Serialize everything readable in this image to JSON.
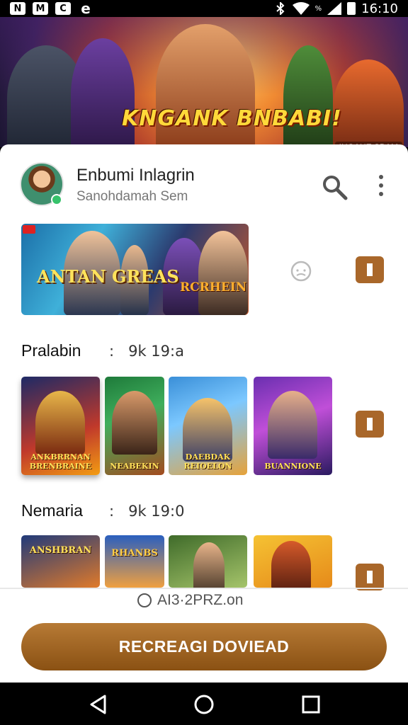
{
  "status_bar": {
    "battery_pct": "%",
    "time": "16:10",
    "icons": [
      "n-icon",
      "m-icon",
      "c-icon",
      "e-icon"
    ],
    "left_glyphs": [
      "N",
      "M",
      "C",
      "e"
    ]
  },
  "banner": {
    "title": "KNGANK BNBABI!",
    "badge": "IHGAHE SBAM"
  },
  "app": {
    "name": "Enbumi Inlagrin",
    "subtitle": "Sanohdamah Sem"
  },
  "featured": {
    "title_left": "ANTAN GREAS",
    "title_right": "RCRHEIN"
  },
  "sections": [
    {
      "title": "Pralabin",
      "meta_sep": ":",
      "meta": "9k 19:a",
      "tiles": [
        "ANKBRRNAN BRENBRAINE",
        "NEABEKIN",
        "DAEBDAK REIOELON",
        "BUANNIONE"
      ]
    },
    {
      "title": "Nemaria",
      "meta_sep": ":",
      "meta": "9k 19:0",
      "tiles": [
        "ANSHBRAN",
        "RHANBS",
        "",
        ""
      ]
    }
  ],
  "footer": {
    "text": "AI3·2PRZ.on",
    "cta_label": "RECREAGI DOVIEAD"
  },
  "colors": {
    "accent": "#a9672a",
    "cta": "#9a5e1f"
  }
}
